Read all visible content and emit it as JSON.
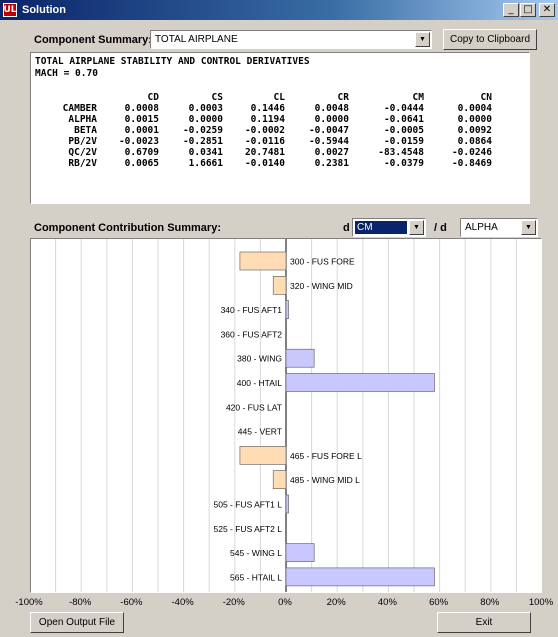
{
  "window": {
    "title": "Solution",
    "app_icon": "UL",
    "buttons": {
      "minimize": "_",
      "maximize": "□",
      "close": "✕"
    }
  },
  "component_summary": {
    "label": "Component Summary:",
    "selected": "TOTAL AIRPLANE",
    "copy_button": "Copy to Clipboard"
  },
  "report": {
    "title": "TOTAL AIRPLANE STABILITY AND CONTROL DERIVATIVES",
    "mach": "MACH = 0.70",
    "columns": [
      "CD",
      "CS",
      "CL",
      "CR",
      "CM",
      "CN"
    ],
    "rows": [
      {
        "name": "CAMBER",
        "values": [
          "0.0008",
          "0.0003",
          "0.1446",
          "0.0048",
          "-0.0444",
          "0.0004"
        ]
      },
      {
        "name": "ALPHA",
        "values": [
          "0.0015",
          "0.0000",
          "0.1194",
          "0.0000",
          "-0.0641",
          "0.0000"
        ]
      },
      {
        "name": "BETA",
        "values": [
          "0.0001",
          "-0.0259",
          "-0.0002",
          "-0.0047",
          "-0.0005",
          "0.0092"
        ]
      },
      {
        "name": "PB/2V",
        "values": [
          "-0.0023",
          "-0.2851",
          "-0.0116",
          "-0.5944",
          "-0.0159",
          "0.0864"
        ]
      },
      {
        "name": "QC/2V",
        "values": [
          "0.6709",
          "0.0341",
          "20.7481",
          "0.0027",
          "-83.4548",
          "-0.0246"
        ]
      },
      {
        "name": "RB/2V",
        "values": [
          "0.0065",
          "1.6661",
          "-0.0140",
          "0.2381",
          "-0.0379",
          "-0.8469"
        ]
      }
    ]
  },
  "contribution": {
    "label": "Component Contribution Summary:",
    "d_label": "d",
    "numerator": "CM",
    "slash_label": "/ d",
    "denominator": "ALPHA"
  },
  "chart_data": {
    "type": "bar",
    "orientation": "horizontal",
    "xlim": [
      -100,
      100
    ],
    "x_unit": "%",
    "x_ticks": [
      "-100%",
      "-80%",
      "-60%",
      "-40%",
      "-20%",
      "0%",
      "20%",
      "40%",
      "60%",
      "80%",
      "100%"
    ],
    "grid": true,
    "positive_color": "#c8c8ff",
    "negative_color": "#ffdcb4",
    "categories": [
      "300 - FUS FORE",
      "320 - WING MID",
      "340 - FUS AFT1",
      "360 - FUS AFT2",
      "380 - WING",
      "400 - HTAIL",
      "420 - FUS LAT",
      "445 - VERT",
      "465 - FUS FORE L",
      "485 - WING MID L",
      "505 - FUS AFT1 L",
      "525 - FUS AFT2 L",
      "545 - WING L",
      "565 - HTAIL L"
    ],
    "values": [
      -18,
      -5,
      1,
      0,
      11,
      58,
      0,
      0,
      -18,
      -5,
      1,
      0,
      11,
      58
    ]
  },
  "footer": {
    "open_button": "Open Output File",
    "exit_button": "Exit"
  }
}
